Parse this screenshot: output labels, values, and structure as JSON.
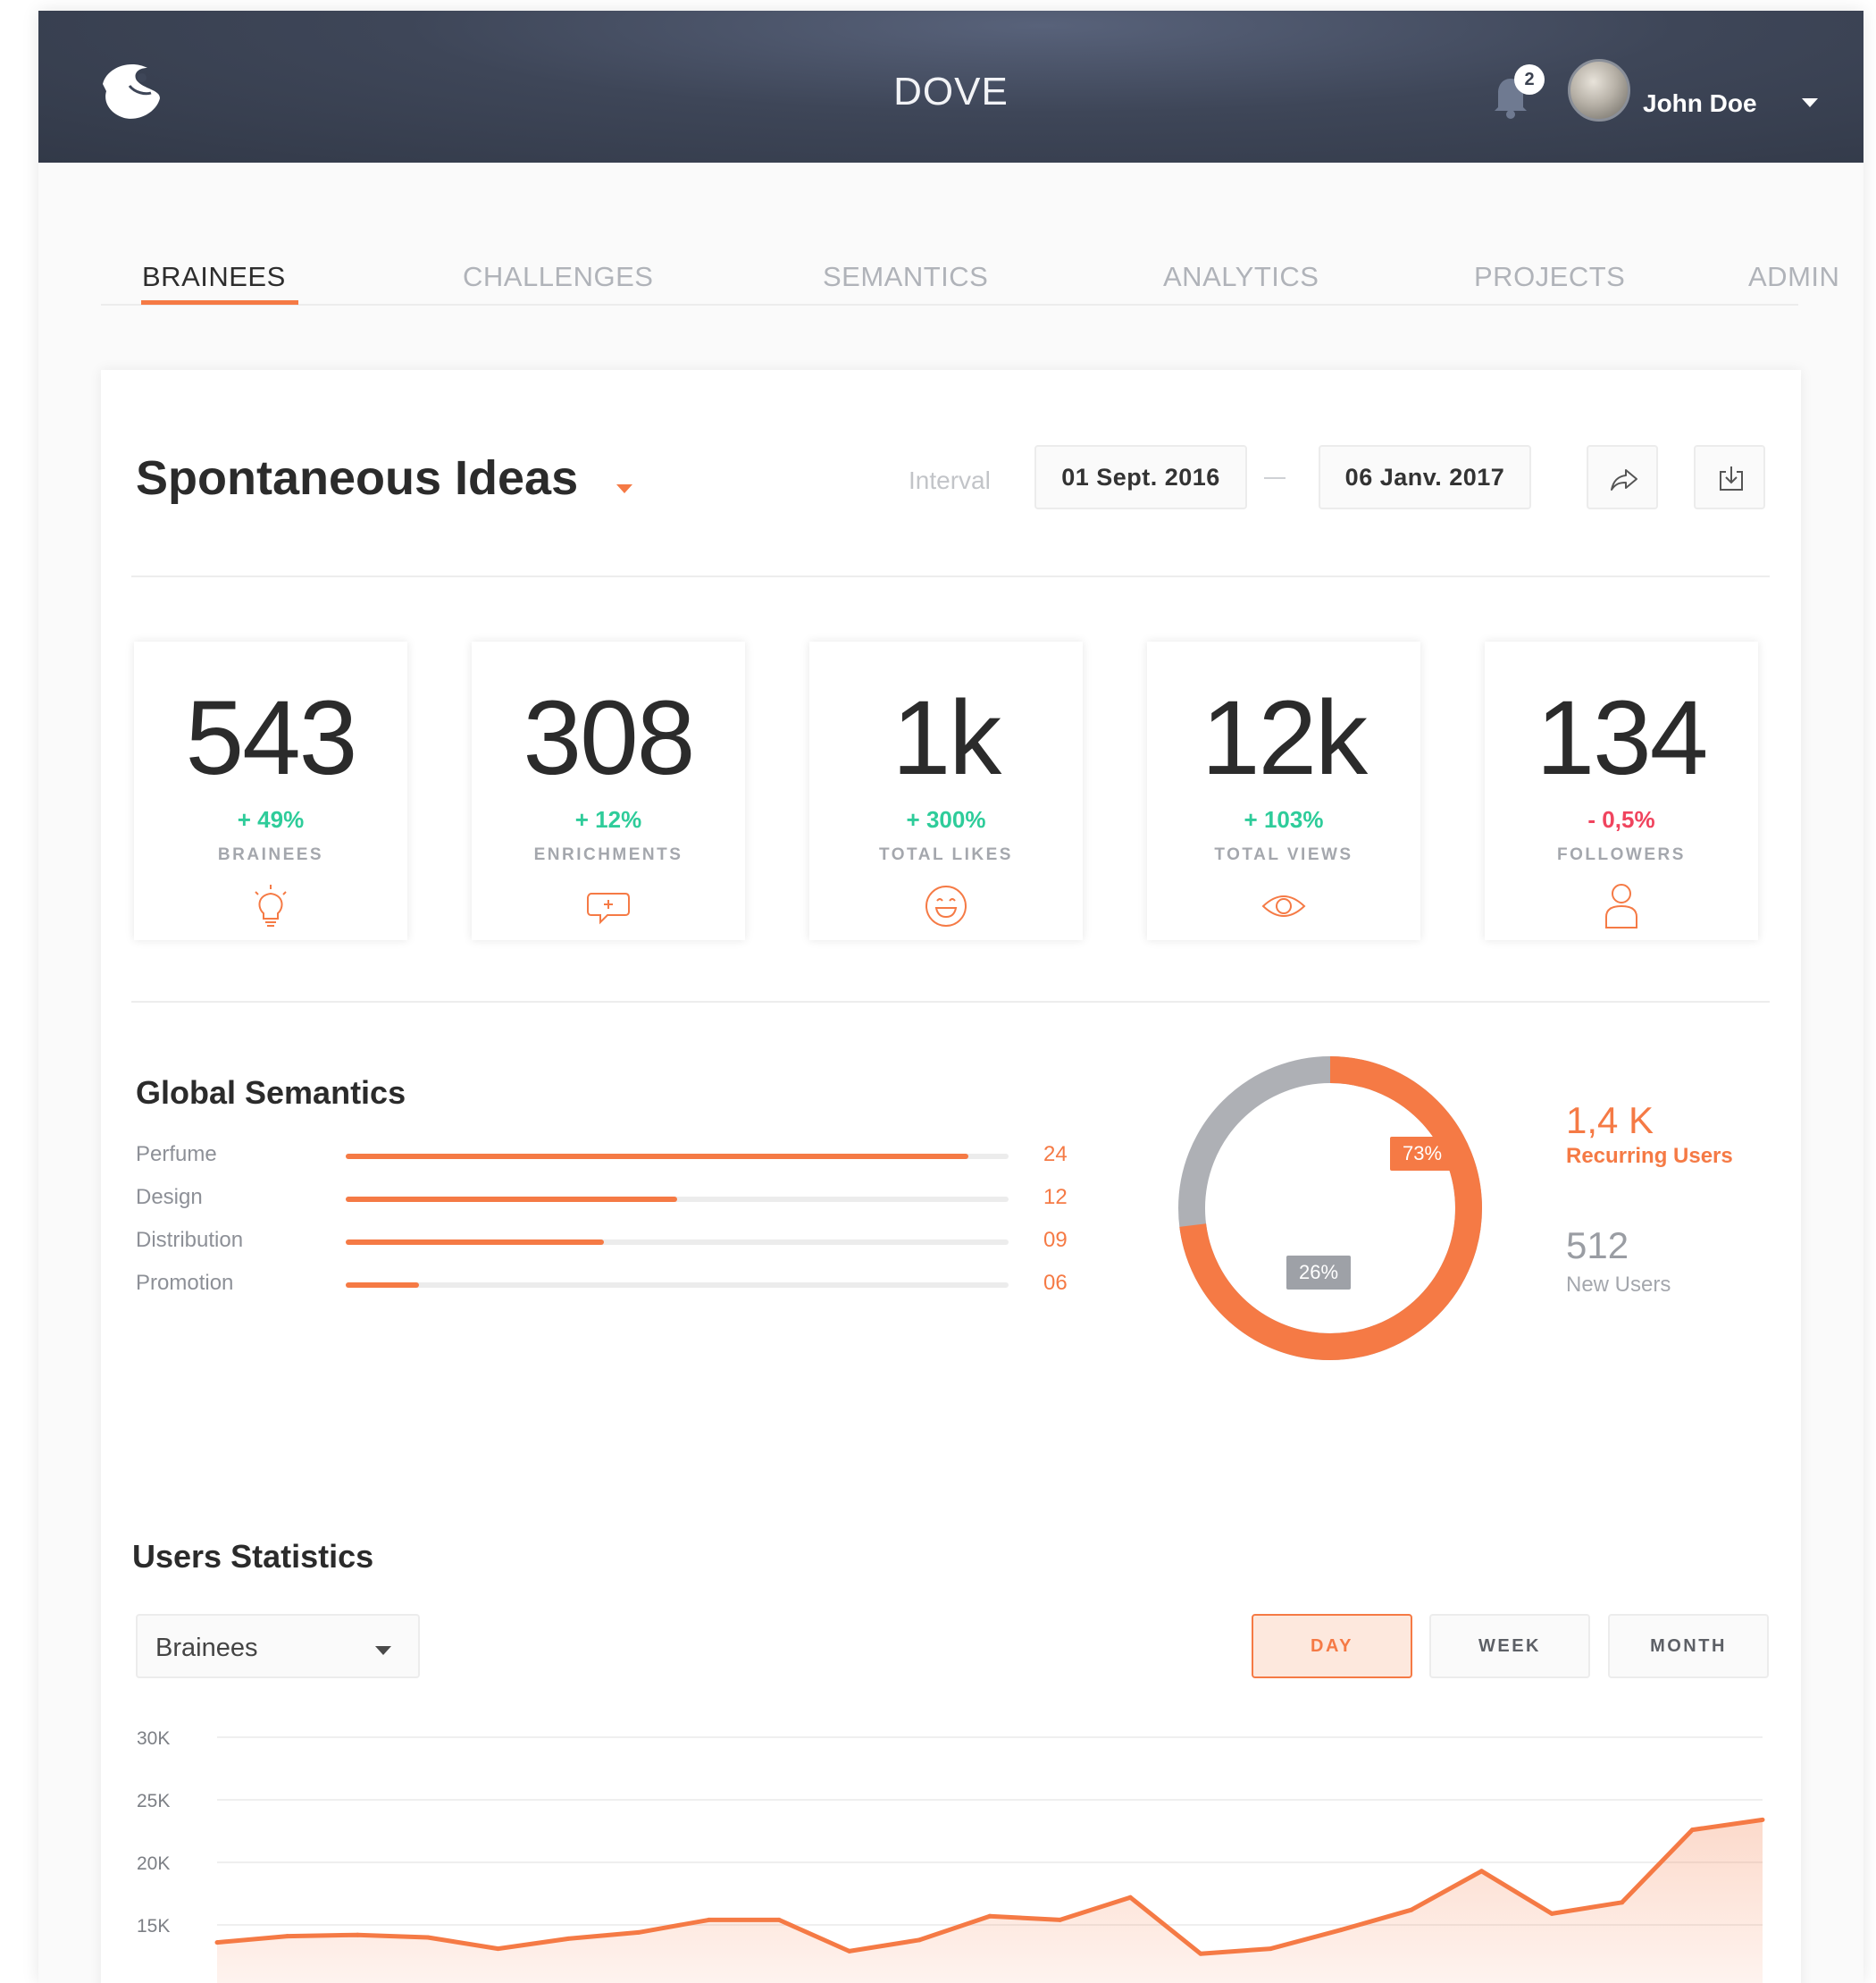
{
  "app": {
    "title": "DOVE"
  },
  "header": {
    "notification_count": "2",
    "user_name": "John Doe"
  },
  "tabs": [
    {
      "label": "BRAINEES",
      "active": true
    },
    {
      "label": "CHALLENGES",
      "active": false
    },
    {
      "label": "SEMANTICS",
      "active": false
    },
    {
      "label": "ANALYTICS",
      "active": false
    },
    {
      "label": "PROJECTS",
      "active": false
    },
    {
      "label": "ADMIN",
      "active": false
    }
  ],
  "dashboard": {
    "title": "Spontaneous Ideas",
    "interval_label": "Interval",
    "date_from": "01 Sept. 2016",
    "date_to": "06 Janv. 2017"
  },
  "stats": [
    {
      "value": "543",
      "delta": "+ 49%",
      "label": "BRAINEES",
      "trend": "up",
      "icon": "lightbulb-icon"
    },
    {
      "value": "308",
      "delta": "+ 12%",
      "label": "ENRICHMENTS",
      "trend": "up",
      "icon": "chat-bubble-icon"
    },
    {
      "value": "1k",
      "delta": "+ 300%",
      "label": "TOTAL LIKES",
      "trend": "up",
      "icon": "smiley-icon"
    },
    {
      "value": "12k",
      "delta": "+ 103%",
      "label": "TOTAL VIEWS",
      "trend": "up",
      "icon": "eye-icon"
    },
    {
      "value": "134",
      "delta": "- 0,5%",
      "label": "FOLLOWERS",
      "trend": "down",
      "icon": "user-icon"
    }
  ],
  "global_semantics": {
    "title": "Global Semantics",
    "items": [
      {
        "label": "Perfume",
        "value": "24",
        "fraction": 0.94
      },
      {
        "label": "Design",
        "value": "12",
        "fraction": 0.5
      },
      {
        "label": "Distribution",
        "value": "09",
        "fraction": 0.39
      },
      {
        "label": "Promotion",
        "value": "06",
        "fraction": 0.11
      }
    ]
  },
  "users_split": {
    "recurring_pct": "73%",
    "new_pct": "26%",
    "recurring_value": "1,4 K",
    "recurring_label": "Recurring Users",
    "new_value": "512",
    "new_label": "New Users"
  },
  "users_statistics": {
    "title": "Users Statistics",
    "selected": "Brainees",
    "periods": [
      {
        "label": "DAY",
        "active": true
      },
      {
        "label": "WEEK",
        "active": false
      },
      {
        "label": "MONTH",
        "active": false
      }
    ]
  },
  "colors": {
    "accent": "#f57a45",
    "positive": "#2ecc9a",
    "negative": "#f0445e",
    "grey_segment": "#aeb0b5",
    "header_bg": "#3e4658"
  },
  "chart_data": {
    "type": "area",
    "y_ticks": [
      "30K",
      "25K",
      "20K",
      "15K"
    ],
    "ylim": [
      10000,
      30000
    ],
    "series": [
      {
        "values": [
          13600,
          14100,
          14200,
          14000,
          13100,
          13900,
          14400,
          15400,
          15400,
          12900,
          13800,
          15700,
          15400,
          17200,
          12700,
          13100,
          14600,
          16200,
          19300,
          15900,
          16800,
          22600,
          23400
        ]
      }
    ]
  }
}
